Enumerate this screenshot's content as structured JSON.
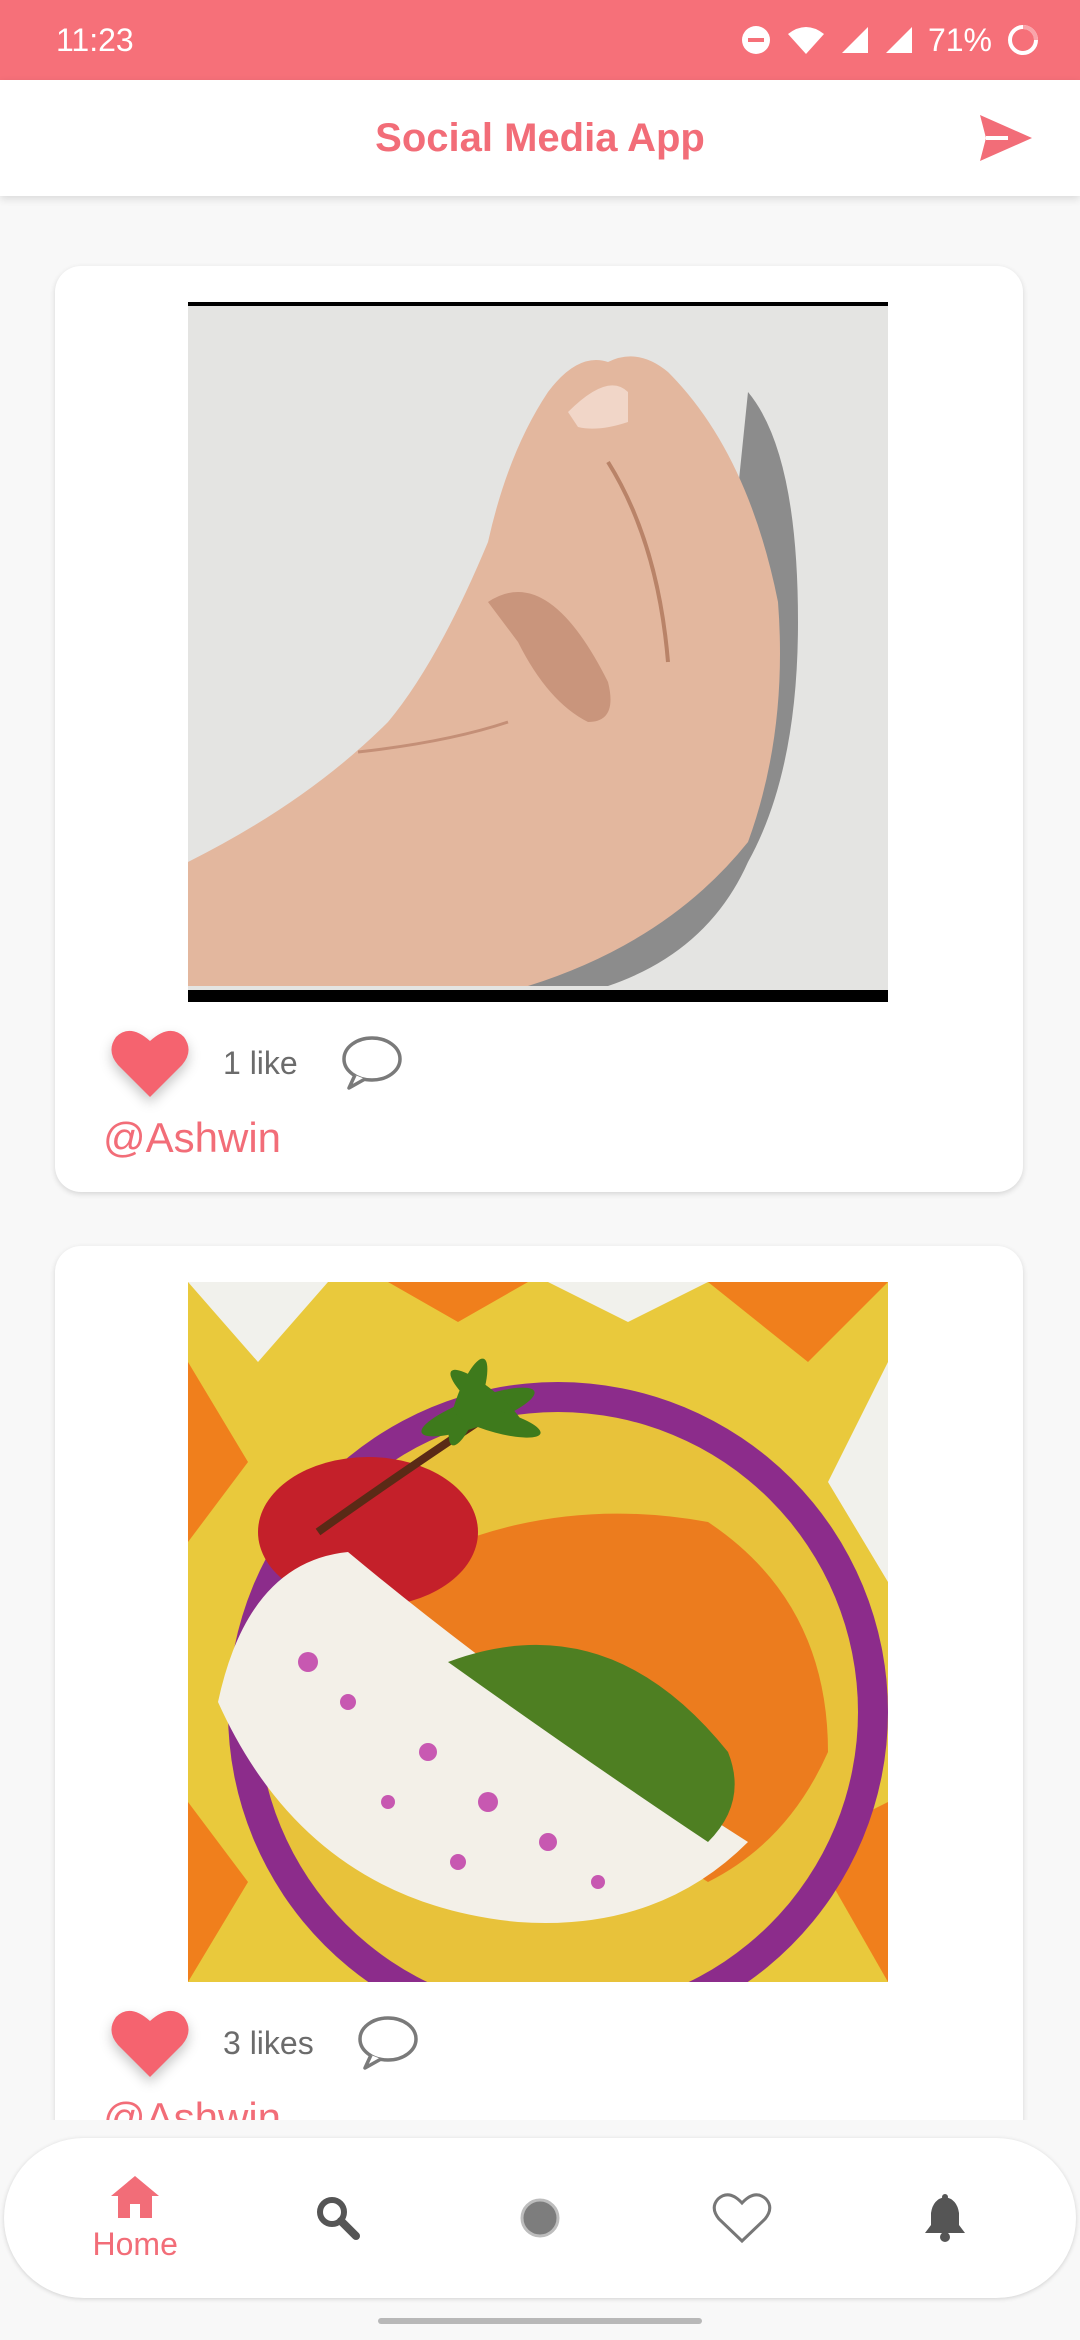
{
  "status_bar": {
    "time": "11:23",
    "battery": "71%"
  },
  "app_bar": {
    "title": "Social Media App"
  },
  "posts": [
    {
      "likes_label": "1 like",
      "author": "@Ashwin",
      "image_icon": "hand-gesture-photo"
    },
    {
      "likes_label": "3 likes",
      "author": "@Ashwin",
      "image_icon": "flower-rangoli-photo"
    }
  ],
  "bottom_nav": {
    "items": [
      {
        "icon": "home-icon",
        "label": "Home",
        "active": true
      },
      {
        "icon": "search-icon",
        "label": ""
      },
      {
        "icon": "add-post-icon",
        "label": ""
      },
      {
        "icon": "heart-outline-icon",
        "label": ""
      },
      {
        "icon": "bell-icon",
        "label": ""
      }
    ]
  },
  "colors": {
    "accent": "#f26d78",
    "status_bar": "#f67079",
    "heart": "#f5636f"
  }
}
